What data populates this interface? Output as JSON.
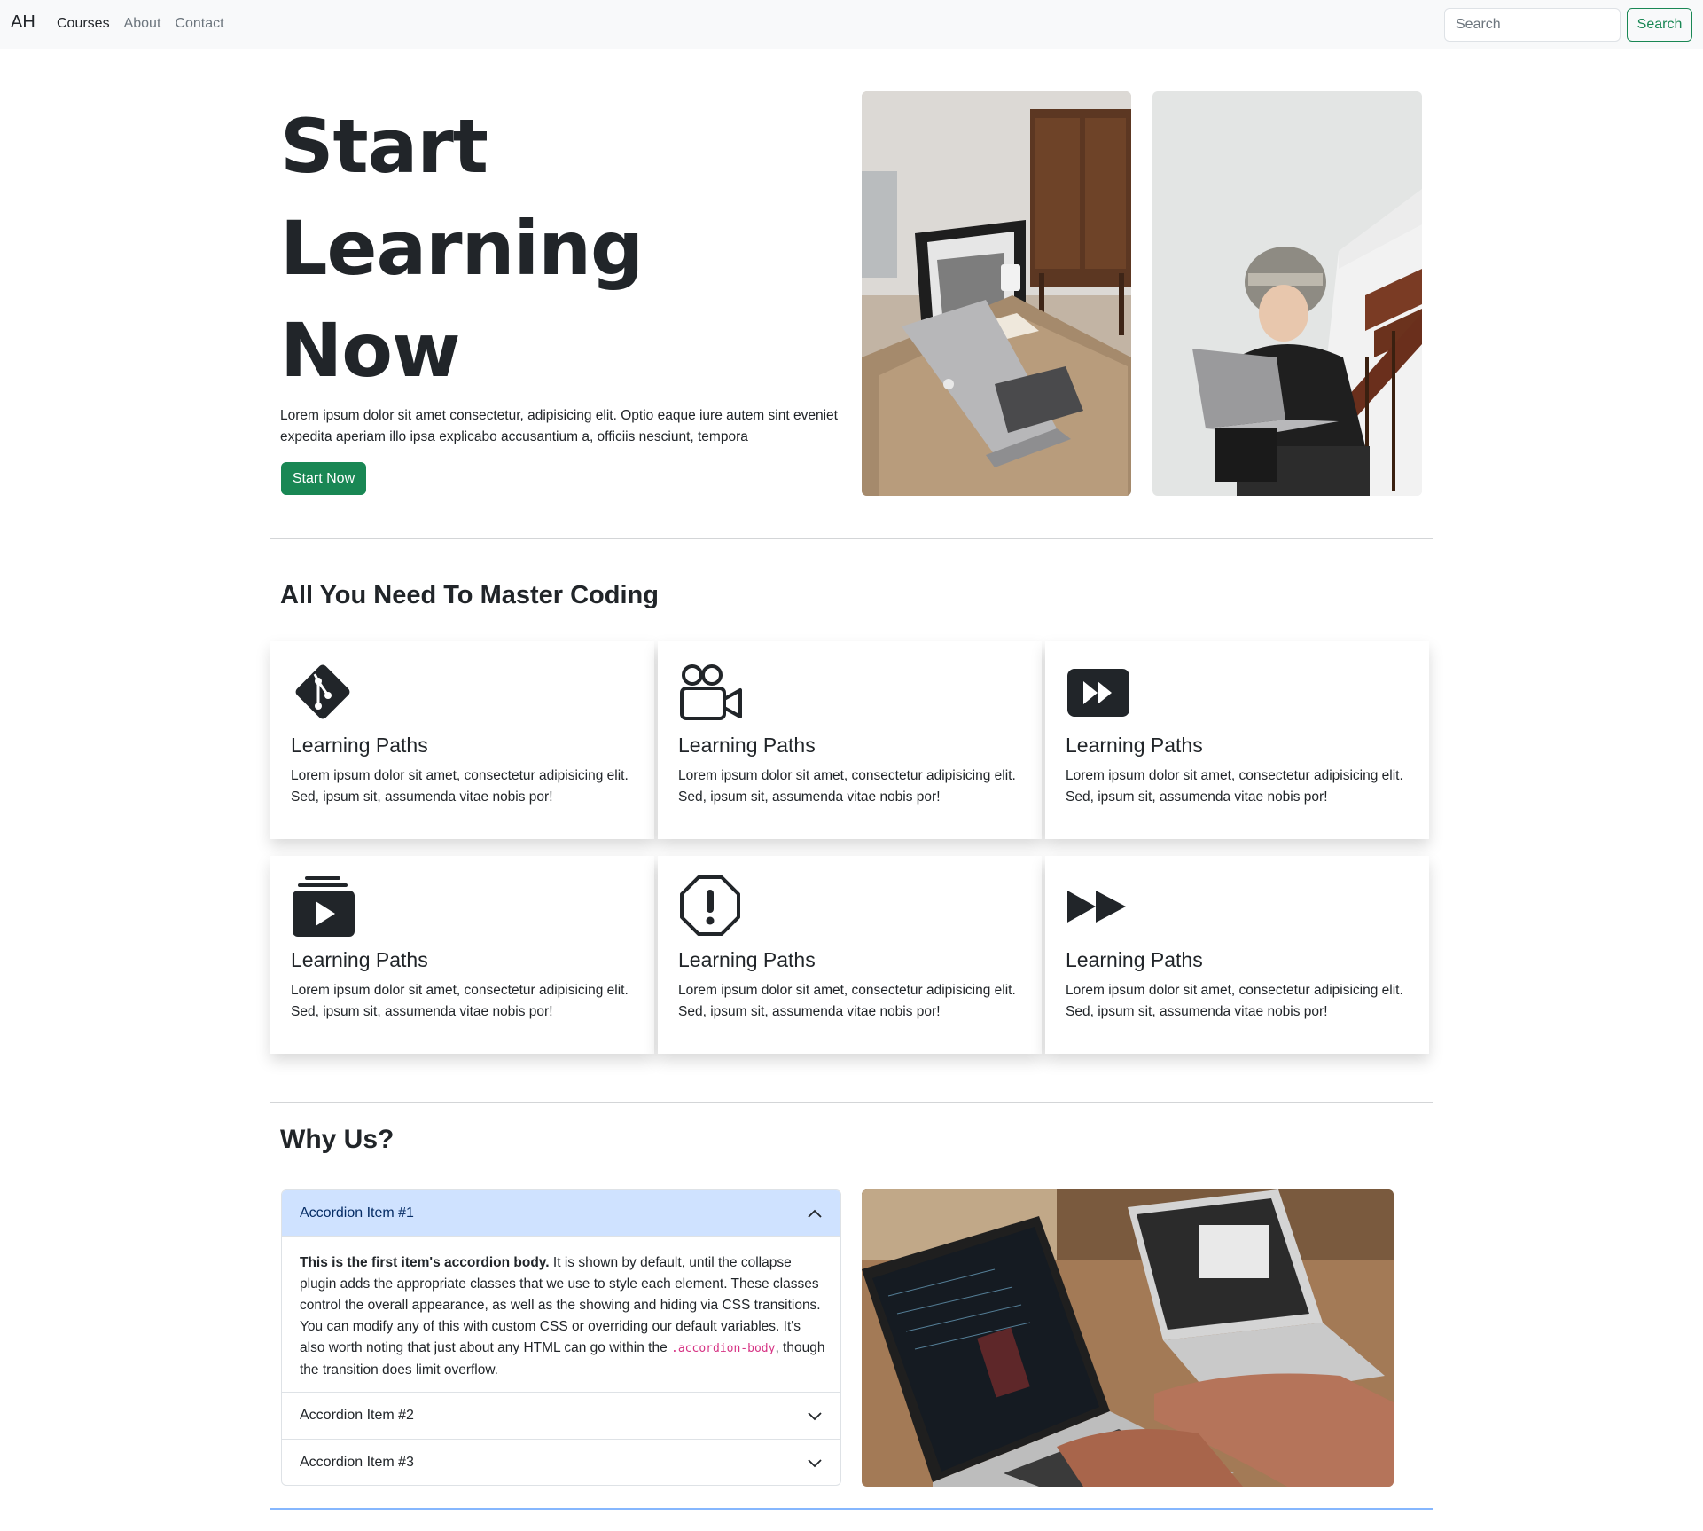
{
  "navbar": {
    "brand": "AH",
    "links": [
      {
        "label": "Courses",
        "active": true
      },
      {
        "label": "About",
        "active": false
      },
      {
        "label": "Contact",
        "active": false
      }
    ],
    "search_placeholder": "Search",
    "search_button": "Search"
  },
  "hero": {
    "title_lines": [
      "Start",
      "Learning",
      "Now"
    ],
    "text": "Lorem ipsum dolor sit amet consectetur, adipisicing elit. Optio eaque iure autem sint eveniet expedita aperiam illo ipsa explicabo accusantium a, officiis nesciunt, tempora",
    "button": "Start Now"
  },
  "features": {
    "title": "All You Need To Master Coding",
    "cards": [
      {
        "icon": "git-icon",
        "title": "Learning Paths",
        "text": "Lorem ipsum dolor sit amet, consectetur adipisicing elit. Sed, ipsum sit, assumenda vitae nobis por!"
      },
      {
        "icon": "camera-reels-icon",
        "title": "Learning Paths",
        "text": "Lorem ipsum dolor sit amet, consectetur adipisicing elit. Sed, ipsum sit, assumenda vitae nobis por!"
      },
      {
        "icon": "fast-forward-btn-icon",
        "title": "Learning Paths",
        "text": "Lorem ipsum dolor sit amet, consectetur adipisicing elit. Sed, ipsum sit, assumenda vitae nobis por!"
      },
      {
        "icon": "collection-play-icon",
        "title": "Learning Paths",
        "text": "Lorem ipsum dolor sit amet, consectetur adipisicing elit. Sed, ipsum sit, assumenda vitae nobis por!"
      },
      {
        "icon": "exclamation-octagon-icon",
        "title": "Learning Paths",
        "text": "Lorem ipsum dolor sit amet, consectetur adipisicing elit. Sed, ipsum sit, assumenda vitae nobis por!"
      },
      {
        "icon": "fast-forward-icon",
        "title": "Learning Paths",
        "text": "Lorem ipsum dolor sit amet, consectetur adipisicing elit. Sed, ipsum sit, assumenda vitae nobis por!"
      }
    ]
  },
  "why": {
    "title": "Why Us?",
    "accordion": [
      {
        "label": "Accordion Item #1",
        "open": true,
        "body_strong": "This is the first item's accordion body.",
        "body_text": " It is shown by default, until the collapse plugin adds the appropriate classes that we use to style each element. These classes control the overall appearance, as well as the showing and hiding via CSS transitions. You can modify any of this with custom CSS or overriding our default variables. It's also worth noting that just about any HTML can go within the ",
        "body_code": ".accordion-body",
        "body_end": ", though the transition does limit overflow."
      },
      {
        "label": "Accordion Item #2",
        "open": false
      },
      {
        "label": "Accordion Item #3",
        "open": false
      }
    ]
  },
  "colors": {
    "accent_green": "#198754",
    "navbar_bg": "#f8f9fa",
    "accordion_active_bg": "#cfe2ff",
    "code_pink": "#d63384"
  }
}
